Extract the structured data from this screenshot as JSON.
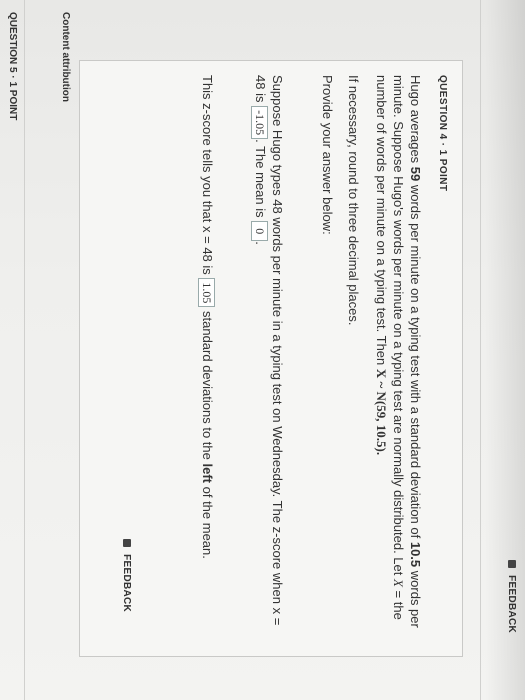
{
  "header": {
    "top_feedback": "FEEDBACK",
    "content_attribution_top": "Content attribution"
  },
  "question4": {
    "label": "QUESTION 4 · 1 POINT",
    "p1_prefix": "Hugo averages ",
    "p1_bold": "59",
    "p1_mid": " words per minute on a typing test with a standard deviation of ",
    "p1_bold2": "10.5",
    "p1_rest": " words per minute. Suppose Hugo's words per minute on a typing test are normally distributed. Let ",
    "p1_var": "X",
    "p1_rest2": " = the number of words per minute on a typing test. Then ",
    "p1_dist": "X ~ N(59, 10.5).",
    "p2": "If necessary, round to three decimal places.",
    "p3": "Provide your answer below:",
    "p4_a": "Suppose Hugo types 48 words per minute in a typing test on Wednesday. The z-score when x = 48 is ",
    "p4_z": "-1.05",
    "p4_b": ". The mean is ",
    "p4_mean": "0",
    "p4_c": ".",
    "p5_a": "This z-score tells you that x = 48 is ",
    "p5_val": "1.05",
    "p5_b": " standard deviations to the ",
    "p5_bold": "left",
    "p5_c": " of the mean.",
    "feedback": "FEEDBACK"
  },
  "footer": {
    "content_attribution": "Content attribution",
    "question5_label": "QUESTION 5 · 1 POINT"
  }
}
